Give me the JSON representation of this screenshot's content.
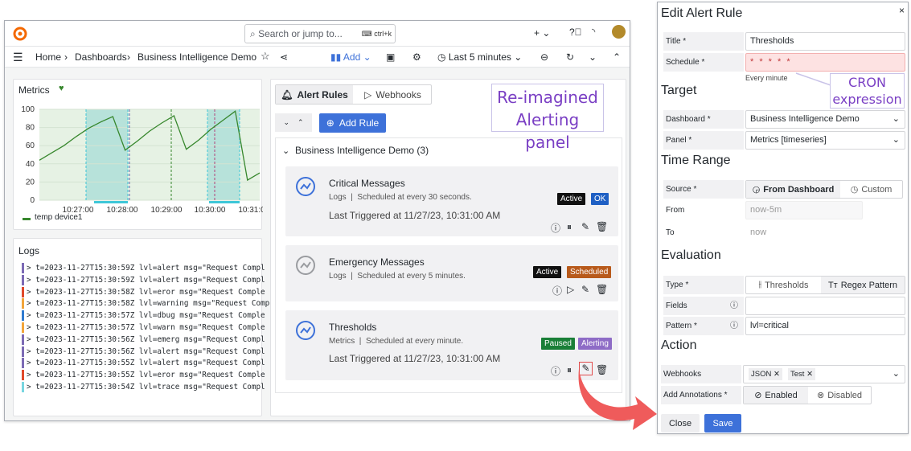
{
  "topbar": {
    "search_placeholder": "Search or jump to...",
    "search_shortcut": "ctrl+k",
    "plus_label": "+ ⌄"
  },
  "breadcrumb": {
    "home": "Home",
    "sep1": "›",
    "dashboards": "Dashboards",
    "sep2": "›",
    "current": "Business Intelligence Demo"
  },
  "toolbar": {
    "add_label": "Add",
    "time_range": "Last 5 minutes"
  },
  "metrics_panel": {
    "title": "Metrics",
    "y_ticks": [
      "100",
      "80",
      "60",
      "40",
      "20",
      "0"
    ],
    "x_ticks": [
      "10:27:00",
      "10:28:00",
      "10:29:00",
      "10:30:00",
      "10:31:0"
    ],
    "legend": "temp device1",
    "legend_color": "#37872d"
  },
  "logs_panel": {
    "title": "Logs",
    "lines": [
      {
        "text": "> t=2023-11-27T15:30:59Z lvl=alert msg=\"Request Compl",
        "color": "#7c6bb5"
      },
      {
        "text": "> t=2023-11-27T15:30:59Z lvl=alert msg=\"Request Compl",
        "color": "#7c6bb5"
      },
      {
        "text": "> t=2023-11-27T15:30:58Z lvl=eror msg=\"Request Comple",
        "color": "#e0492b"
      },
      {
        "text": "> t=2023-11-27T15:30:58Z lvl=warning msg=\"Request Comp",
        "color": "#f2a53b"
      },
      {
        "text": "> t=2023-11-27T15:30:57Z lvl=dbug msg=\"Request Comple",
        "color": "#2f7bd0"
      },
      {
        "text": "> t=2023-11-27T15:30:57Z lvl=warn msg=\"Request Comple",
        "color": "#f2a53b"
      },
      {
        "text": "> t=2023-11-27T15:30:56Z lvl=emerg msg=\"Request Compl",
        "color": "#7c6bb5"
      },
      {
        "text": "> t=2023-11-27T15:30:56Z lvl=alert msg=\"Request Compl",
        "color": "#7c6bb5"
      },
      {
        "text": "> t=2023-11-27T15:30:55Z lvl=alert msg=\"Request Compl",
        "color": "#7c6bb5"
      },
      {
        "text": "> t=2023-11-27T15:30:55Z lvl=eror msg=\"Request Comple",
        "color": "#e0492b"
      },
      {
        "text": "> t=2023-11-27T15:30:54Z lvl=trace msg=\"Request Compl",
        "color": "#78d6e0"
      }
    ]
  },
  "alerting": {
    "tab_rules": "Alert Rules",
    "tab_webhooks": "Webhooks",
    "add_rule": "Add Rule",
    "group": "Business Intelligence Demo (3)",
    "rules": [
      {
        "title": "Critical Messages",
        "source": "Logs",
        "schedule": "Scheduled at every 30 seconds.",
        "last": "Last Triggered at 11/27/23, 10:31:00 AM",
        "badge1": "Active",
        "badge2": "OK"
      },
      {
        "title": "Emergency Messages",
        "source": "Logs",
        "schedule": "Scheduled at every 5 minutes.",
        "last": "",
        "badge1": "Active",
        "badge2": "Scheduled"
      },
      {
        "title": "Thresholds",
        "source": "Metrics",
        "schedule": "Scheduled at every minute.",
        "last": "Last Triggered at 11/27/23, 10:31:00 AM",
        "badge1": "Paused",
        "badge2": "Alerting"
      }
    ]
  },
  "annotation_panel": "Re-imagined\nAlerting panel",
  "annotation_cron": "CRON\nexpression",
  "edit": {
    "title": "Edit Alert Rule",
    "close_x": "×",
    "title_label": "Title *",
    "title_value": "Thresholds",
    "schedule_label": "Schedule *",
    "schedule_value": "* * * * *",
    "schedule_hint": "Every minute",
    "target": "Target",
    "dashboard_label": "Dashboard *",
    "dashboard_value": "Business Intelligence Demo",
    "panel_label": "Panel *",
    "panel_value": "Metrics [timeseries]",
    "time_range": "Time Range",
    "source_label": "Source *",
    "source_on": "From Dashboard",
    "source_off": "Custom",
    "from_label": "From",
    "from_value": "now-5m",
    "to_label": "To",
    "to_value": "now",
    "evaluation": "Evaluation",
    "type_label": "Type *",
    "type_off": "Thresholds",
    "type_on": "Regex Pattern",
    "fields_label": "Fields",
    "pattern_label": "Pattern *",
    "pattern_value": "lvl=critical",
    "action": "Action",
    "webhooks_label": "Webhooks",
    "chips": [
      "JSON",
      "Test"
    ],
    "annot_label": "Add Annotations *",
    "annot_on": "Enabled",
    "annot_off": "Disabled",
    "close_btn": "Close",
    "save_btn": "Save"
  },
  "chart_data": {
    "type": "line",
    "series": [
      {
        "name": "temp device1",
        "values": [
          44,
          52,
          60,
          70,
          79,
          86,
          92,
          55,
          65,
          76,
          85,
          93,
          56,
          66,
          78,
          88,
          98,
          22,
          30
        ]
      }
    ],
    "ylim": [
      0,
      100
    ],
    "x_ticks": [
      "10:27:00",
      "10:28:00",
      "10:29:00",
      "10:30:00",
      "10:31:0"
    ]
  }
}
